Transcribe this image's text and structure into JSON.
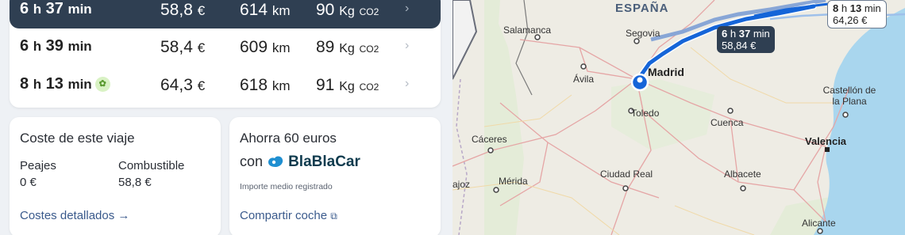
{
  "routes": [
    {
      "hours": "6",
      "minutes": "37",
      "price": "58,8",
      "price_unit": "€",
      "km": "614",
      "km_unit": "km",
      "co2": "90",
      "co2_unit": "Kg",
      "co2_sub": "CO2",
      "selected": true
    },
    {
      "hours": "6",
      "minutes": "39",
      "price": "58,4",
      "price_unit": "€",
      "km": "609",
      "km_unit": "km",
      "co2": "89",
      "co2_unit": "Kg",
      "co2_sub": "CO2",
      "selected": false
    },
    {
      "hours": "8",
      "minutes": "13",
      "price": "64,3",
      "price_unit": "€",
      "km": "618",
      "km_unit": "km",
      "co2": "91",
      "co2_unit": "Kg",
      "co2_sub": "CO2",
      "selected": false
    }
  ],
  "units": {
    "h": "h",
    "min": "min"
  },
  "cost": {
    "title": "Coste de este viaje",
    "tolls_label": "Peajes",
    "tolls_value": "0 €",
    "fuel_label": "Combustible",
    "fuel_value": "58,8 €",
    "link": "Costes detallados →"
  },
  "blablacar": {
    "title": "Ahorra 60 euros",
    "con": "con",
    "brand": "BlaBlaCar",
    "note": "Importe medio registrado",
    "link": "Compartir coche"
  },
  "map": {
    "country": "ESPAÑA",
    "cities": [
      "Salamanca",
      "Segovia",
      "Madrid",
      "Ávila",
      "Toledo",
      "Castellón de la Plana",
      "Cuenca",
      "Valencia",
      "Cáceres",
      "Ciudad Real",
      "Albacete",
      "Mérida",
      "ajoz",
      "Alicante"
    ],
    "bubble_main": {
      "h": "6",
      "hl": "h",
      "m": "37",
      "ml": "min",
      "price": "58,84 €"
    },
    "bubble_alt": {
      "h": "8",
      "hl": "h",
      "m": "13",
      "ml": "min",
      "price": "64,26 €"
    }
  },
  "colors": {
    "selected_row": "#2f3f52",
    "route_line": "#1565d8",
    "link": "#3a5a8c"
  }
}
